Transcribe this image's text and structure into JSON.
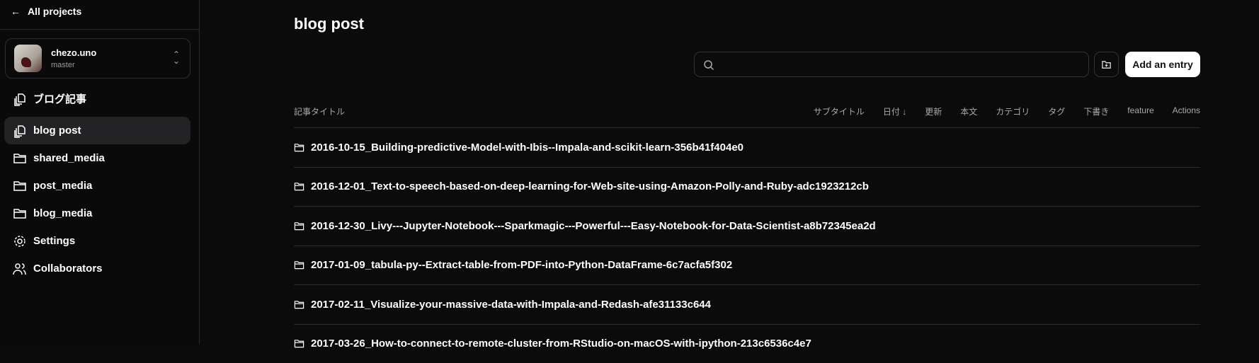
{
  "sidebar": {
    "back_label": "All projects",
    "project": {
      "name": "chezo.uno",
      "branch": "master"
    },
    "items": [
      {
        "label": "ブログ記事",
        "icon": "copy-icon"
      },
      {
        "label": "blog post",
        "icon": "copy-icon",
        "active": true
      },
      {
        "label": "shared_media",
        "icon": "folder-icon"
      },
      {
        "label": "post_media",
        "icon": "folder-icon"
      },
      {
        "label": "blog_media",
        "icon": "folder-icon"
      },
      {
        "label": "Settings",
        "icon": "gear-icon"
      },
      {
        "label": "Collaborators",
        "icon": "users-icon"
      }
    ]
  },
  "main": {
    "title": "blog post",
    "search": {
      "value": "",
      "placeholder": ""
    },
    "add_label": "Add an entry",
    "columns": {
      "first": "記事タイトル",
      "others": [
        "サブタイトル",
        "日付 ↓",
        "更新",
        "本文",
        "カテゴリ",
        "タグ",
        "下書き",
        "feature",
        "Actions"
      ]
    },
    "rows": [
      "2016-10-15_Building-predictive-Model-with-Ibis--Impala-and-scikit-learn-356b41f404e0",
      "2016-12-01_Text-to-speech-based-on-deep-learning-for-Web-site-using-Amazon-Polly-and-Ruby-adc1923212cb",
      "2016-12-30_Livy---Jupyter-Notebook---Sparkmagic---Powerful---Easy-Notebook-for-Data-Scientist-a8b72345ea2d",
      "2017-01-09_tabula-py--Extract-table-from-PDF-into-Python-DataFrame-6c7acfa5f302",
      "2017-02-11_Visualize-your-massive-data-with-Impala-and-Redash-afe31133c644",
      "2017-03-26_How-to-connect-to-remote-cluster-from-RStudio-on-macOS-with-ipython-213c6536c4e7"
    ]
  }
}
